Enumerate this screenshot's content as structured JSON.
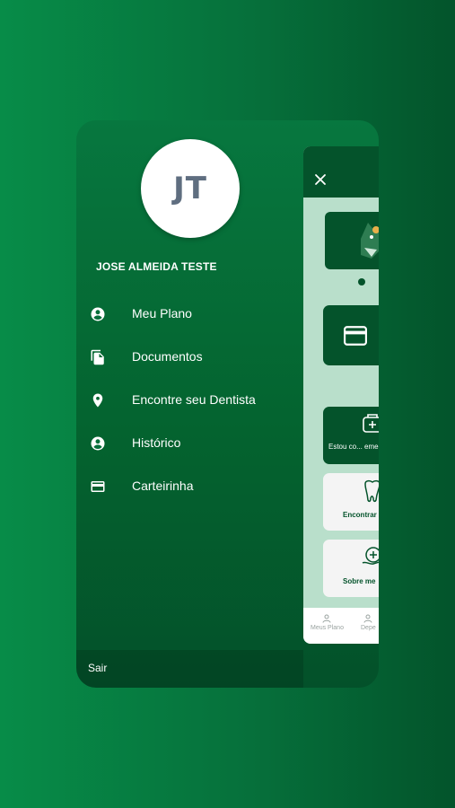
{
  "user": {
    "initials": "JT",
    "name": "JOSE ALMEIDA TESTE"
  },
  "menu": {
    "items": [
      {
        "label": "Meu Plano",
        "icon": "account-circle-icon"
      },
      {
        "label": "Documentos",
        "icon": "documents-icon"
      },
      {
        "label": "Encontre seu Dentista",
        "icon": "location-pin-icon"
      },
      {
        "label": "Histórico",
        "icon": "account-circle-icon"
      },
      {
        "label": "Carteirinha",
        "icon": "card-icon"
      }
    ]
  },
  "footer": {
    "logout_label": "Sair"
  },
  "background_app": {
    "cards": {
      "emergency": "Estou co... emerg...",
      "find": "Encontrar",
      "about": "Sobre me"
    },
    "bottom_nav": {
      "plans": "Meus Plano",
      "dependents": "Depe"
    }
  },
  "colors": {
    "brand_green": "#078c48",
    "dark_green": "#04532b",
    "light_green": "#b9dfcb"
  }
}
